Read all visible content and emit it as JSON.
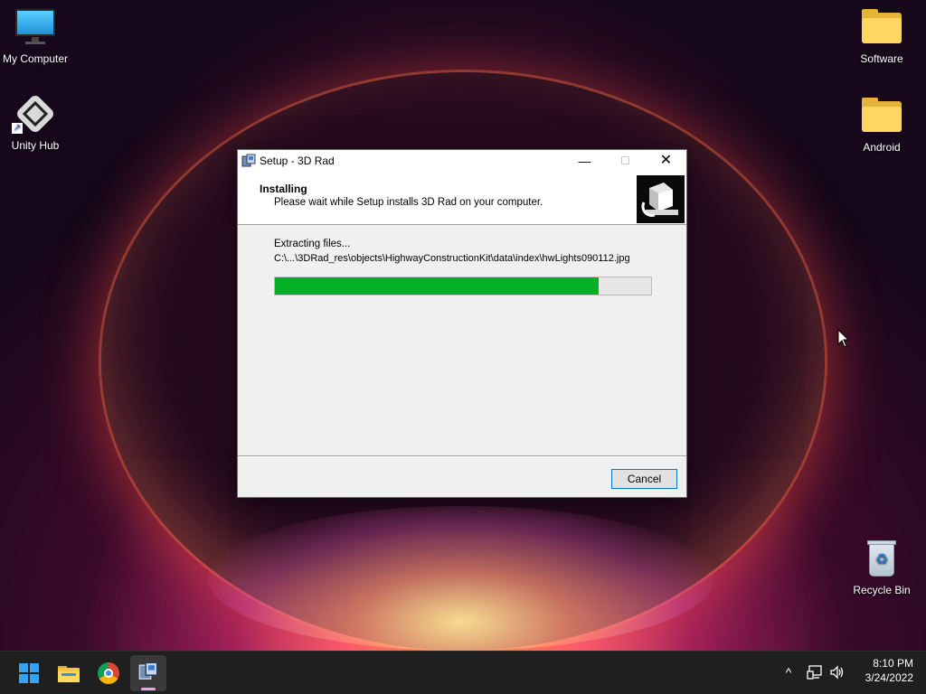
{
  "desktop": {
    "icons": [
      {
        "label": "My Computer"
      },
      {
        "label": "Unity Hub"
      },
      {
        "label": "Software"
      },
      {
        "label": "Android"
      },
      {
        "label": "Recycle Bin"
      }
    ]
  },
  "dialog": {
    "title": "Setup - 3D Rad",
    "header_title": "Installing",
    "header_subtitle": "Please wait while Setup installs 3D Rad on your computer.",
    "status": "Extracting files...",
    "current_file": "C:\\...\\3DRad_res\\objects\\HighwayConstructionKit\\data\\index\\hwLights090112.jpg",
    "progress_percent": 86,
    "cancel_label": "Cancel",
    "controls": {
      "minimize": "—",
      "maximize": "☐",
      "close": "✕"
    }
  },
  "taskbar": {
    "time": "8:10 PM",
    "date": "3/24/2022",
    "tray_chevron": "^",
    "apps": [
      "start",
      "file-explorer",
      "chrome",
      "3d-rad-setup"
    ]
  },
  "colors": {
    "progress_fill": "#06b025",
    "accent": "#0078d7",
    "taskbar": "#1f1f1f"
  }
}
